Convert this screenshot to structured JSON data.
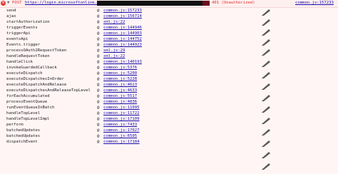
{
  "header": {
    "method": "POST",
    "url": "https://login.microsoftonline.com/",
    "status": "401 (Unauthorized)",
    "source": "common.js:157233",
    "icons": {
      "error": "error-icon",
      "expand": "triangle-down-icon"
    }
  },
  "stack": [
    {
      "fn": "send",
      "src": "common.js:157233"
    },
    {
      "fn": "ajax",
      "src": "common.js:156714"
    },
    {
      "fn": "startAuthorization",
      "src": "xml.js:22"
    },
    {
      "fn": "triggerEvents",
      "src": "common.js:144946"
    },
    {
      "fn": "triggerApi",
      "src": "common.js:144903"
    },
    {
      "fn": "eventsApi",
      "src": "common.js:144752"
    },
    {
      "fn": "Events.trigger",
      "src": "common.js:144923"
    },
    {
      "fn": "processOAuth2RequestToken",
      "src": "xml.js:29"
    },
    {
      "fn": "handleRequestToken",
      "src": "xml.js:22"
    },
    {
      "fn": "handleClick",
      "src": "common.js:140193"
    },
    {
      "fn": "invokeGuardedCallback",
      "src": "common.js:5376"
    },
    {
      "fn": "executeDispatch",
      "src": "common.js:5200"
    },
    {
      "fn": "executeDispatchesInOrder",
      "src": "common.js:5228"
    },
    {
      "fn": "executeDispatchAndRelease",
      "src": "common.js:4623"
    },
    {
      "fn": "executeDispatchesAndReleaseTopLevel",
      "src": "common.js:4633"
    },
    {
      "fn": "forEachAccumulated",
      "src": "common.js:5517"
    },
    {
      "fn": "processEventQueue",
      "src": "common.js:4836"
    },
    {
      "fn": "runEventQueueInBatch",
      "src": "common.js:11095"
    },
    {
      "fn": "handleTopLevel",
      "src": "common.js:11722"
    },
    {
      "fn": "handleTopLevelImpl",
      "src": "common.js:17109"
    },
    {
      "fn": "perform",
      "src": "common.js:7433"
    },
    {
      "fn": "batchedUpdates",
      "src": "common.js:17027"
    },
    {
      "fn": "batchedUpdates",
      "src": "common.js:6595"
    },
    {
      "fn": "dispatchEvent",
      "src": "common.js:17184"
    }
  ],
  "at_symbol": "@",
  "annotation_icon": "pen-icon",
  "colors": {
    "link": "#1a0dab",
    "error": "#d93025",
    "background": "#fff5f5"
  }
}
